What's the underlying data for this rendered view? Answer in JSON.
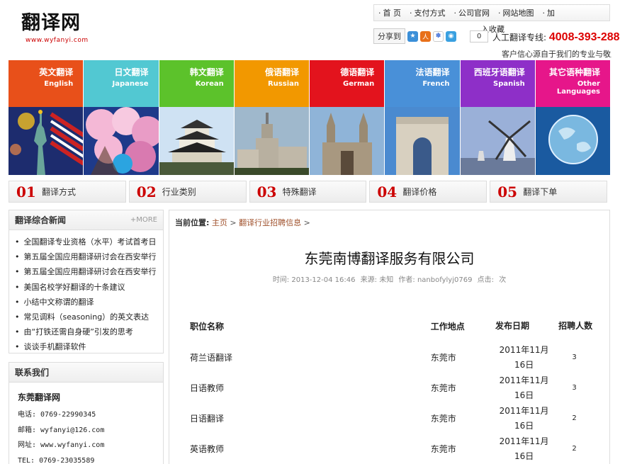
{
  "header": {
    "logo_cn": "翻译网",
    "logo_url": "www.wyfanyi.com",
    "topnav": [
      "首 页",
      "支付方式",
      "公司官网",
      "网站地图",
      "加"
    ],
    "share_label": "分享到",
    "share_count": "0",
    "favorite": "入收藏",
    "hotline_label": "人工翻译专线:",
    "hotline_number": "4008-393-288",
    "slogan": "客户信心源自于我们的专业与敬业"
  },
  "languages": [
    {
      "cn": "英文翻译",
      "en": "English",
      "color": "#e8501a"
    },
    {
      "cn": "日文翻译",
      "en": "Japanese",
      "color": "#52c8d2"
    },
    {
      "cn": "韩文翻译",
      "en": "Korean",
      "color": "#5cc22b"
    },
    {
      "cn": "俄语翻译",
      "en": "Russian",
      "color": "#f29800"
    },
    {
      "cn": "德语翻译",
      "en": "German",
      "color": "#e3131d"
    },
    {
      "cn": "法语翻译",
      "en": "French",
      "color": "#4990d8"
    },
    {
      "cn": "西班牙语翻译",
      "en": "Spanish",
      "color": "#8e2fc8"
    },
    {
      "cn": "其它语种翻译",
      "en": "Other Languages",
      "color": "#e6168a"
    }
  ],
  "services": [
    {
      "num": "01",
      "label": "翻译方式"
    },
    {
      "num": "02",
      "label": "行业类别"
    },
    {
      "num": "03",
      "label": "特殊翻译"
    },
    {
      "num": "04",
      "label": "翻译价格"
    },
    {
      "num": "05",
      "label": "翻译下单"
    }
  ],
  "news": {
    "title": "翻译综合新闻",
    "more": "+MORE",
    "items": [
      "全国翻译专业资格（水平）考试首考日",
      "第五届全国应用翻译研讨会在西安举行",
      "第五届全国应用翻译研讨会在西安举行",
      "美国名校学好翻译的十条建议",
      "小结中文称谓的翻译",
      "常见调料（seasoning）的英文表达",
      "由“打铁还需自身硬”引发的思考",
      "谈谈手机翻译软件"
    ]
  },
  "contact": {
    "title": "联系我们",
    "company": "东莞翻译网",
    "phone": "电话: 0769-22990345",
    "email": "邮箱: wyfanyi@126.com",
    "site": "网址: www.wyfanyi.com",
    "tel": "TEL: 0769-23035589"
  },
  "main": {
    "crumb_here": "当前位置:",
    "crumb_home": "主页",
    "crumb_sep": ">",
    "crumb_cat": "翻译行业招聘信息",
    "title": "东莞南博翻译服务有限公司",
    "meta_time": "时间: 2013-12-04 16:46",
    "meta_source": "来源: 未知",
    "meta_author": "作者: nanbofylyj0769",
    "meta_clicks": "点击:",
    "meta_clicks_unit": "次",
    "table": {
      "headers": [
        "职位名称",
        "工作地点",
        "发布日期",
        "招聘人数"
      ],
      "rows": [
        [
          "荷兰语翻译",
          "东莞市",
          "2011年11月16日",
          "3"
        ],
        [
          "日语教师",
          "东莞市",
          "2011年11月16日",
          "3"
        ],
        [
          "日语翻译",
          "东莞市",
          "2011年11月16日",
          "2"
        ],
        [
          "英语教师",
          "东莞市",
          "2011年11月16日",
          "2"
        ]
      ]
    }
  }
}
